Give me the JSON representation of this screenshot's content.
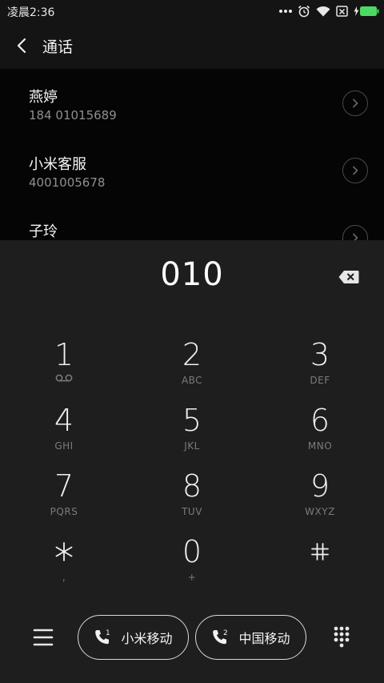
{
  "status_bar": {
    "time": "凌晨2:36",
    "icons": [
      "more-dots-icon",
      "alarm-icon",
      "wifi-icon",
      "sim-off-icon",
      "battery-charging-icon"
    ]
  },
  "header": {
    "back_icon": "back-chevron-icon",
    "title": "通话"
  },
  "contacts": [
    {
      "name": "燕婷",
      "number": "184 01015689"
    },
    {
      "name": "小米客服",
      "number": "4001005678"
    },
    {
      "name": "子玲",
      "number": ""
    }
  ],
  "dialpad": {
    "entered_digits": "010",
    "keys": [
      {
        "num": "1",
        "letters": ""
      },
      {
        "num": "2",
        "letters": "ABC"
      },
      {
        "num": "3",
        "letters": "DEF"
      },
      {
        "num": "4",
        "letters": "GHI"
      },
      {
        "num": "5",
        "letters": "JKL"
      },
      {
        "num": "6",
        "letters": "MNO"
      },
      {
        "num": "7",
        "letters": "PQRS"
      },
      {
        "num": "8",
        "letters": "TUV"
      },
      {
        "num": "9",
        "letters": "WXYZ"
      },
      {
        "num": "*",
        "letters": ","
      },
      {
        "num": "0",
        "letters": "+"
      },
      {
        "num": "#",
        "letters": ""
      }
    ]
  },
  "bottom_bar": {
    "sim1_label": "小米移动",
    "sim1_index": "1",
    "sim2_label": "中国移动",
    "sim2_index": "2"
  },
  "colors": {
    "background": "#1e1e1e",
    "list_background": "#050505",
    "battery": "#4cd964",
    "secondary_text": "#7b7b7b"
  }
}
